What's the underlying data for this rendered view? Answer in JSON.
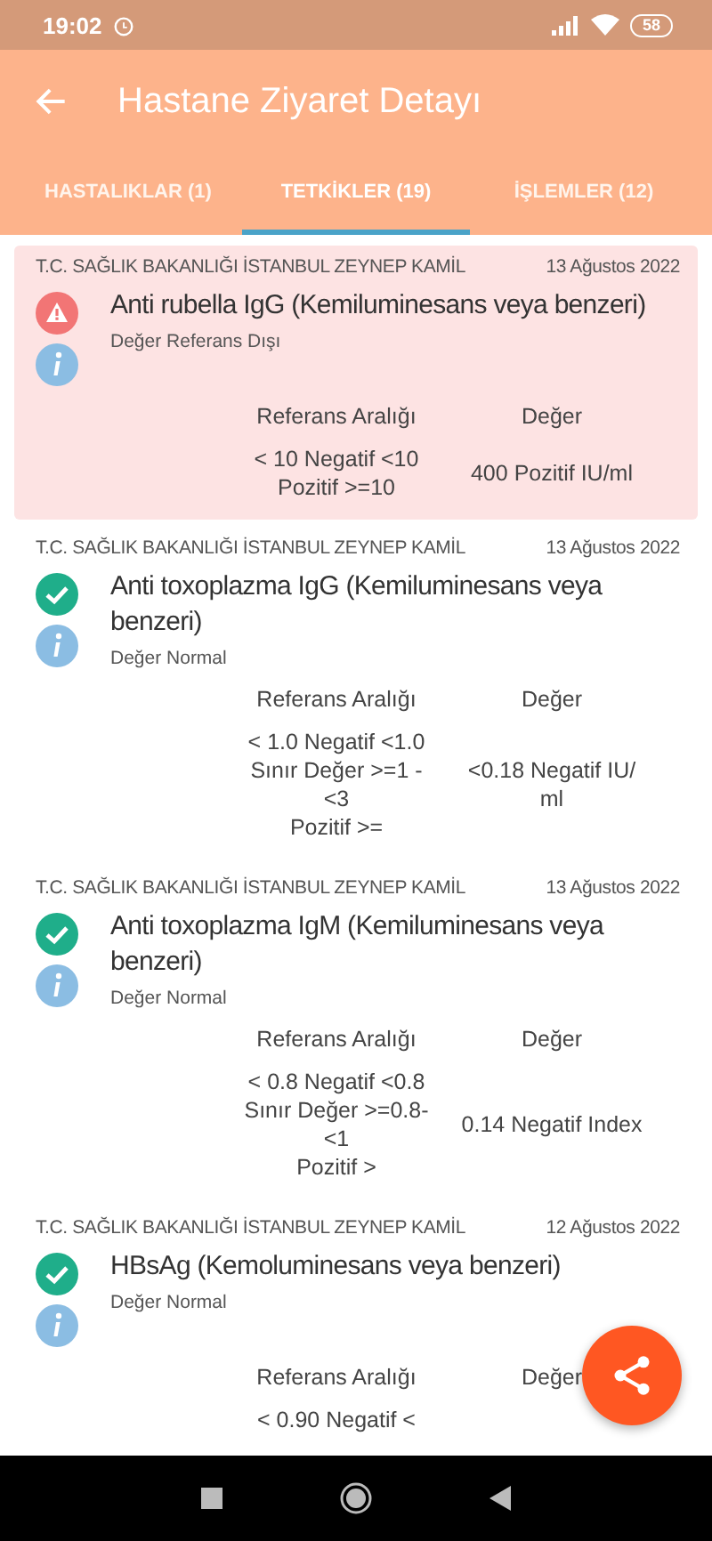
{
  "status_bar": {
    "time": "19:02",
    "battery": "58"
  },
  "app_bar": {
    "title": "Hastane Ziyaret Detayı"
  },
  "tabs": [
    {
      "label": "HASTALIKLAR (1)",
      "selected": false
    },
    {
      "label": "TETKİKLER (19)",
      "selected": true
    },
    {
      "label": "İŞLEMLER (12)",
      "selected": false
    }
  ],
  "results": [
    {
      "hospital": "T.C. SAĞLIK BAKANLIĞI İSTANBUL ZEYNEP KAMİL",
      "date": "13 Ağustos 2022",
      "kind": "warning",
      "title": "Anti rubella IgG (Kemiluminesans veya benzeri)",
      "note": "Değer Referans Dışı",
      "range_header": "Referans Aralığı",
      "value_header": "Değer",
      "range_lines": [
        "< 10 Negatif <10",
        "Pozitif >=10"
      ],
      "value_lines": [
        "400 Pozitif IU/ml"
      ]
    },
    {
      "hospital": "T.C. SAĞLIK BAKANLIĞI İSTANBUL ZEYNEP KAMİL",
      "date": "13 Ağustos 2022",
      "kind": "normal",
      "title": "Anti toxoplazma IgG (Kemiluminesans veya benzeri)",
      "note": "Değer Normal",
      "range_header": "Referans Aralığı",
      "value_header": "Değer",
      "range_lines": [
        "< 1.0 Negatif <1.0",
        "Sınır Değer >=1 -",
        "<3",
        "Pozitif >="
      ],
      "value_lines": [
        "<0.18 Negatif IU/",
        "ml"
      ]
    },
    {
      "hospital": "T.C. SAĞLIK BAKANLIĞI İSTANBUL ZEYNEP KAMİL",
      "date": "13 Ağustos 2022",
      "kind": "normal",
      "title": "Anti toxoplazma IgM (Kemiluminesans veya benzeri)",
      "note": "Değer Normal",
      "range_header": "Referans Aralığı",
      "value_header": "Değer",
      "range_lines": [
        "< 0.8 Negatif <0.8",
        "Sınır Değer >=0.8-",
        "<1",
        "Pozitif >"
      ],
      "value_lines": [
        "0.14 Negatif Index"
      ]
    },
    {
      "hospital": "T.C. SAĞLIK BAKANLIĞI İSTANBUL ZEYNEP KAMİL",
      "date": "12 Ağustos 2022",
      "kind": "normal",
      "title": "HBsAg (Kemoluminesans veya benzeri)",
      "note": "Değer Normal",
      "range_header": "Referans Aralığı",
      "value_header": "Değer",
      "range_lines": [
        "< 0.90 Negatif <"
      ]
    }
  ]
}
